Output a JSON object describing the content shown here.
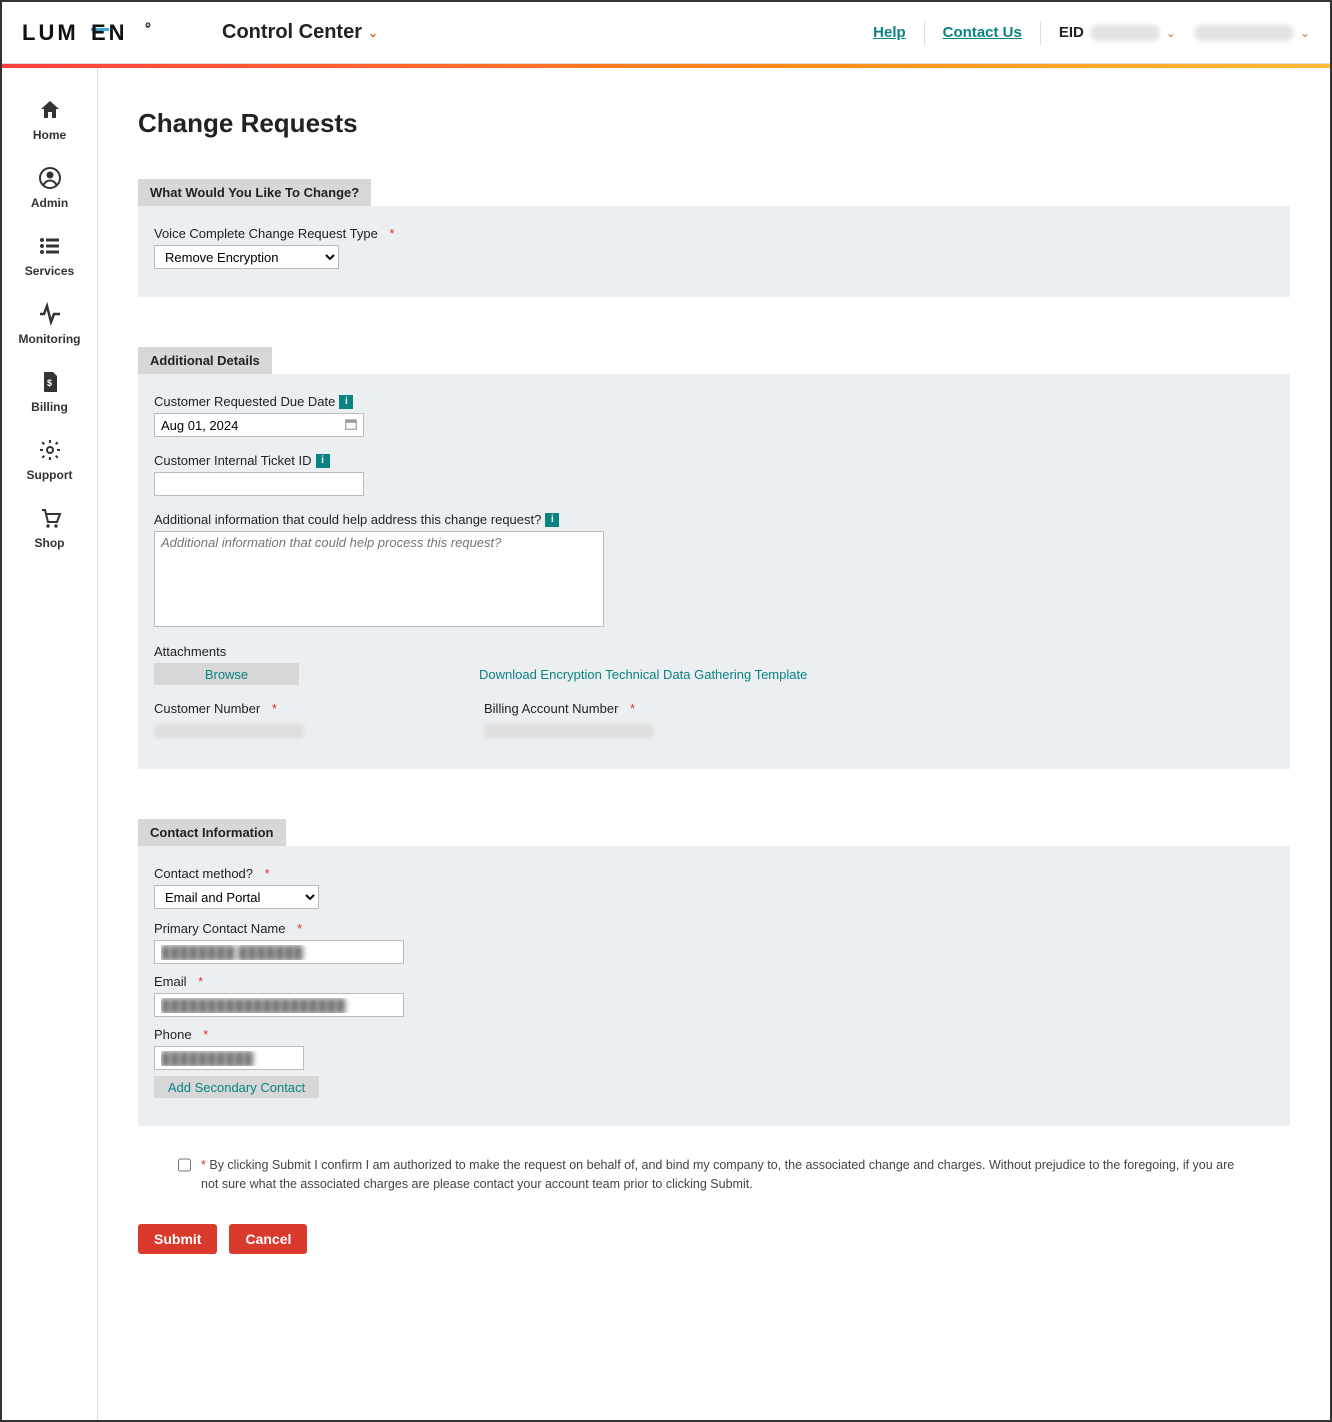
{
  "header": {
    "brand": "LUMEN",
    "app_title": "Control Center",
    "help_label": "Help",
    "contact_label": "Contact Us",
    "eid_label": "EID"
  },
  "sidebar": {
    "items": [
      {
        "label": "Home",
        "icon": "home-icon"
      },
      {
        "label": "Admin",
        "icon": "user-icon"
      },
      {
        "label": "Services",
        "icon": "list-icon"
      },
      {
        "label": "Monitoring",
        "icon": "activity-icon"
      },
      {
        "label": "Billing",
        "icon": "file-icon"
      },
      {
        "label": "Support",
        "icon": "gear-icon"
      },
      {
        "label": "Shop",
        "icon": "cart-icon"
      }
    ]
  },
  "page": {
    "title": "Change Requests"
  },
  "section_change": {
    "title": "What Would You Like To Change?",
    "type_label": "Voice Complete Change Request Type",
    "type_value": "Remove Encryption"
  },
  "section_details": {
    "title": "Additional Details",
    "due_date_label": "Customer Requested Due Date",
    "due_date_value": "Aug 01, 2024",
    "ticket_label": "Customer Internal Ticket ID",
    "ticket_value": "",
    "additional_label": "Additional information that could help address this change request?",
    "additional_placeholder": "Additional information that could help process this request?",
    "additional_value": "",
    "attachments_label": "Attachments",
    "browse_label": "Browse",
    "download_link": "Download Encryption Technical Data Gathering Template",
    "customer_number_label": "Customer Number",
    "billing_account_label": "Billing Account Number"
  },
  "section_contact": {
    "title": "Contact Information",
    "method_label": "Contact method?",
    "method_value": "Email and Portal",
    "name_label": "Primary Contact Name",
    "email_label": "Email",
    "phone_label": "Phone",
    "add_secondary_label": "Add Secondary Contact"
  },
  "confirm": {
    "text": "By clicking Submit I confirm I am authorized to make the request on behalf of, and bind my company to, the associated change and charges. Without prejudice to the foregoing, if you are not sure what the associated charges are please contact your account team prior to clicking Submit."
  },
  "actions": {
    "submit_label": "Submit",
    "cancel_label": "Cancel"
  }
}
